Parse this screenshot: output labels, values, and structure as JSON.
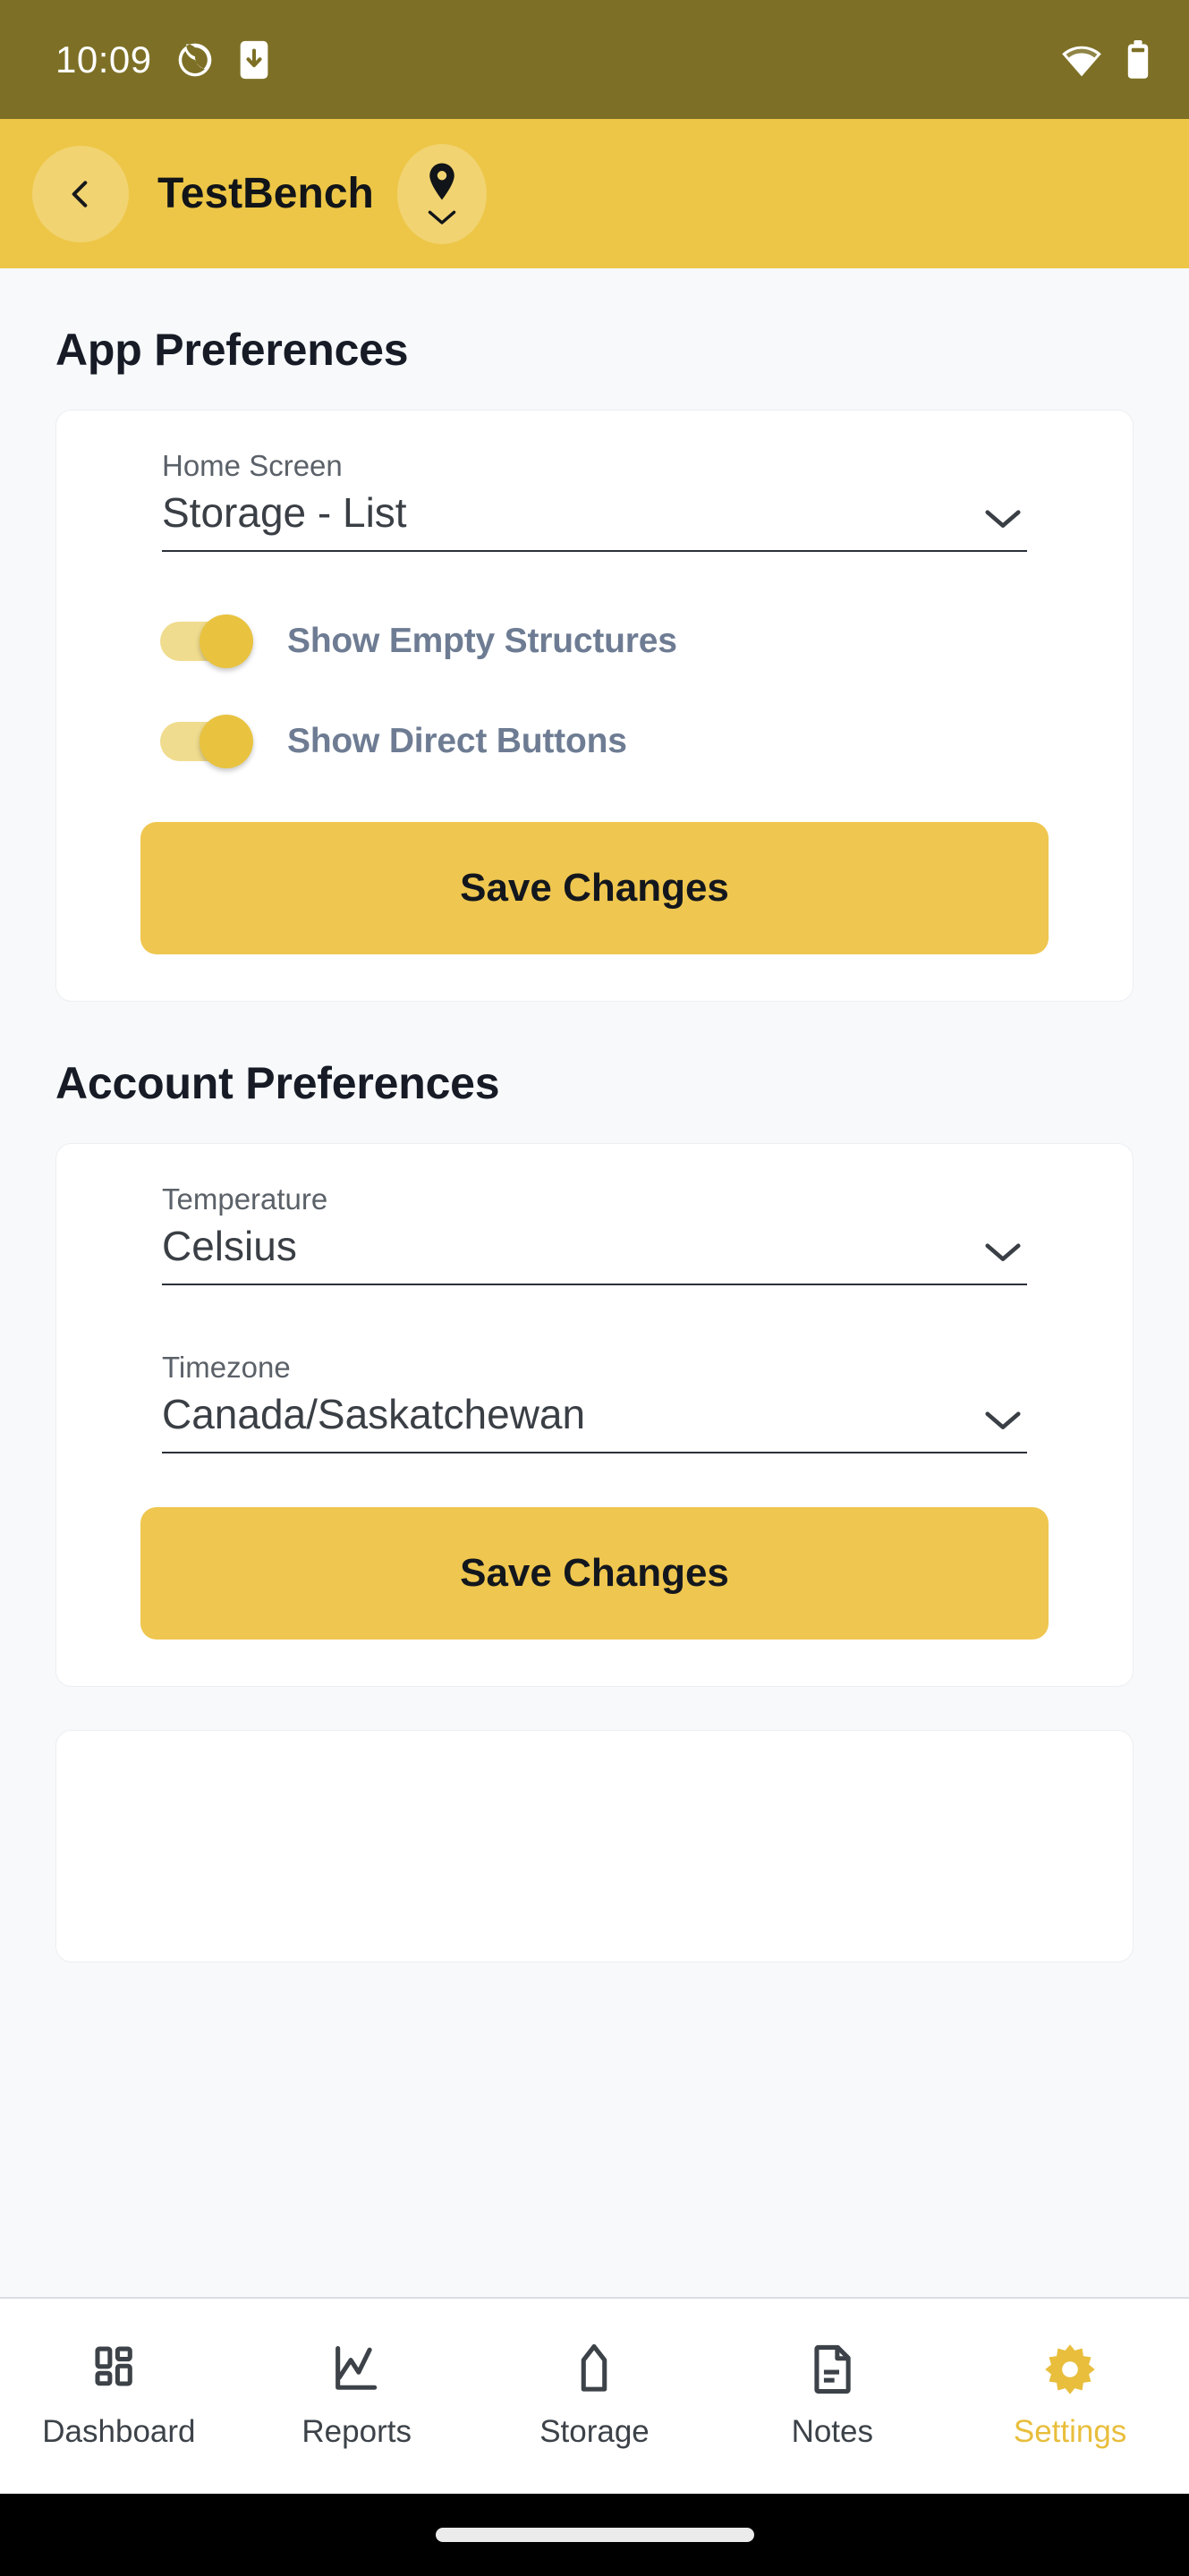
{
  "status_bar": {
    "time": "10:09",
    "icons": [
      "sync-icon",
      "phone-download-icon",
      "wifi-icon",
      "battery-icon"
    ],
    "background_color": "#7D7026"
  },
  "app_bar": {
    "back_icon": "chevron-left-icon",
    "title": "TestBench",
    "location_icon": "map-pin-icon",
    "location_chevron_icon": "chevron-down-icon",
    "background_color": "#EDC647"
  },
  "app_preferences": {
    "section_title": "App Preferences",
    "home_screen": {
      "label": "Home Screen",
      "value": "Storage - List",
      "chevron_icon": "chevron-down-icon"
    },
    "toggles": [
      {
        "label": "Show Empty Structures",
        "state": "on"
      },
      {
        "label": "Show Direct Buttons",
        "state": "on"
      }
    ],
    "save_label": "Save Changes"
  },
  "account_preferences": {
    "section_title": "Account Preferences",
    "temperature": {
      "label": "Temperature",
      "value": "Celsius",
      "chevron_icon": "chevron-down-icon"
    },
    "timezone": {
      "label": "Timezone",
      "value": "Canada/Saskatchewan",
      "chevron_icon": "chevron-down-icon"
    },
    "save_label": "Save Changes"
  },
  "bottom_nav": {
    "active_color": "#E8BE3C",
    "items": [
      {
        "label": "Dashboard",
        "icon": "dashboard-grid-icon",
        "active": false
      },
      {
        "label": "Reports",
        "icon": "line-chart-icon",
        "active": false
      },
      {
        "label": "Storage",
        "icon": "silo-icon",
        "active": false
      },
      {
        "label": "Notes",
        "icon": "document-icon",
        "active": false
      },
      {
        "label": "Settings",
        "icon": "gear-icon",
        "active": true
      }
    ]
  },
  "theme": {
    "accent": "#EDC647",
    "button": "#EFC64F",
    "page_background": "#F7F9FB",
    "card_background": "#FFFFFF",
    "toggle_label_color": "#6E7C93"
  }
}
